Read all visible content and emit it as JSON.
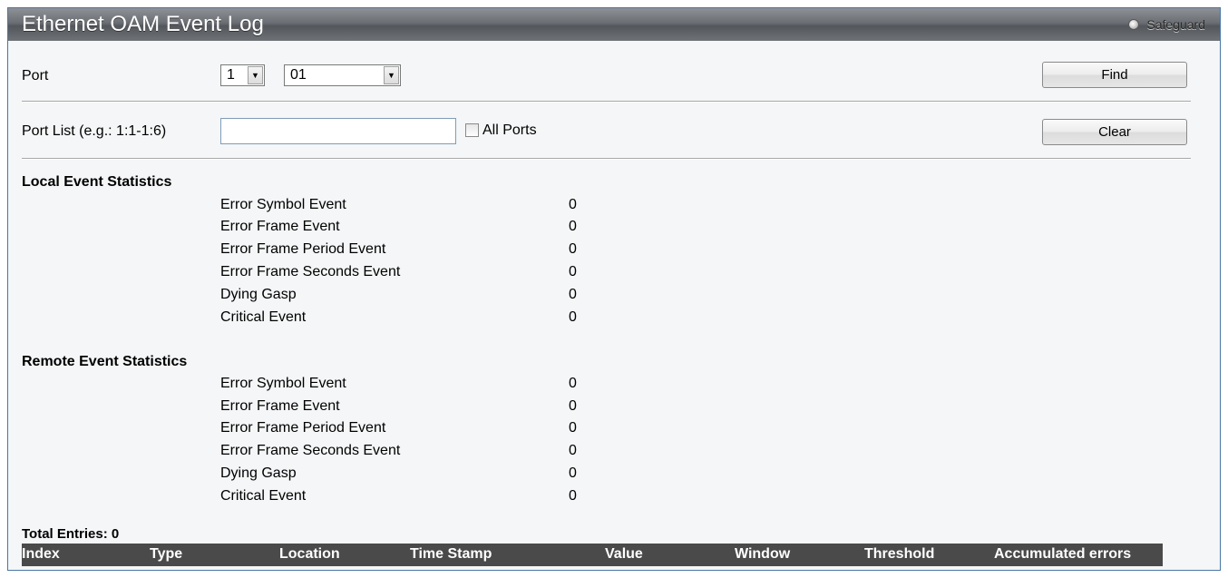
{
  "title": "Ethernet OAM Event Log",
  "safeguard": {
    "label": "Safeguard",
    "icon": "radio-indicator-icon"
  },
  "port": {
    "label": "Port",
    "unit_value": "1",
    "port_value": "01",
    "find_label": "Find"
  },
  "port_list": {
    "label": "Port List (e.g.: 1:1-1:6)",
    "value": "",
    "all_ports_label": "All Ports",
    "all_ports_checked": false,
    "clear_label": "Clear"
  },
  "local": {
    "heading": "Local Event Statistics",
    "rows": [
      {
        "label": "Error Symbol Event",
        "value": "0"
      },
      {
        "label": "Error Frame Event",
        "value": "0"
      },
      {
        "label": "Error Frame Period Event",
        "value": "0"
      },
      {
        "label": "Error Frame Seconds Event",
        "value": "0"
      },
      {
        "label": "Dying Gasp",
        "value": "0"
      },
      {
        "label": "Critical Event",
        "value": "0"
      }
    ]
  },
  "remote": {
    "heading": "Remote Event Statistics",
    "rows": [
      {
        "label": "Error Symbol Event",
        "value": "0"
      },
      {
        "label": "Error Frame Event",
        "value": "0"
      },
      {
        "label": "Error Frame Period Event",
        "value": "0"
      },
      {
        "label": "Error Frame Seconds Event",
        "value": "0"
      },
      {
        "label": "Dying Gasp",
        "value": "0"
      },
      {
        "label": "Critical Event",
        "value": "0"
      }
    ]
  },
  "table": {
    "total_entries": "Total Entries: 0",
    "columns": [
      "Index",
      "Type",
      "Location",
      "Time Stamp",
      "Value",
      "Window",
      "Threshold",
      "Accumulated errors"
    ]
  },
  "colors": {
    "titlebar": "#6b6f74",
    "panel": "#f4f6f7",
    "border": "#4a77a8",
    "table_header": "#4a4a4a"
  }
}
